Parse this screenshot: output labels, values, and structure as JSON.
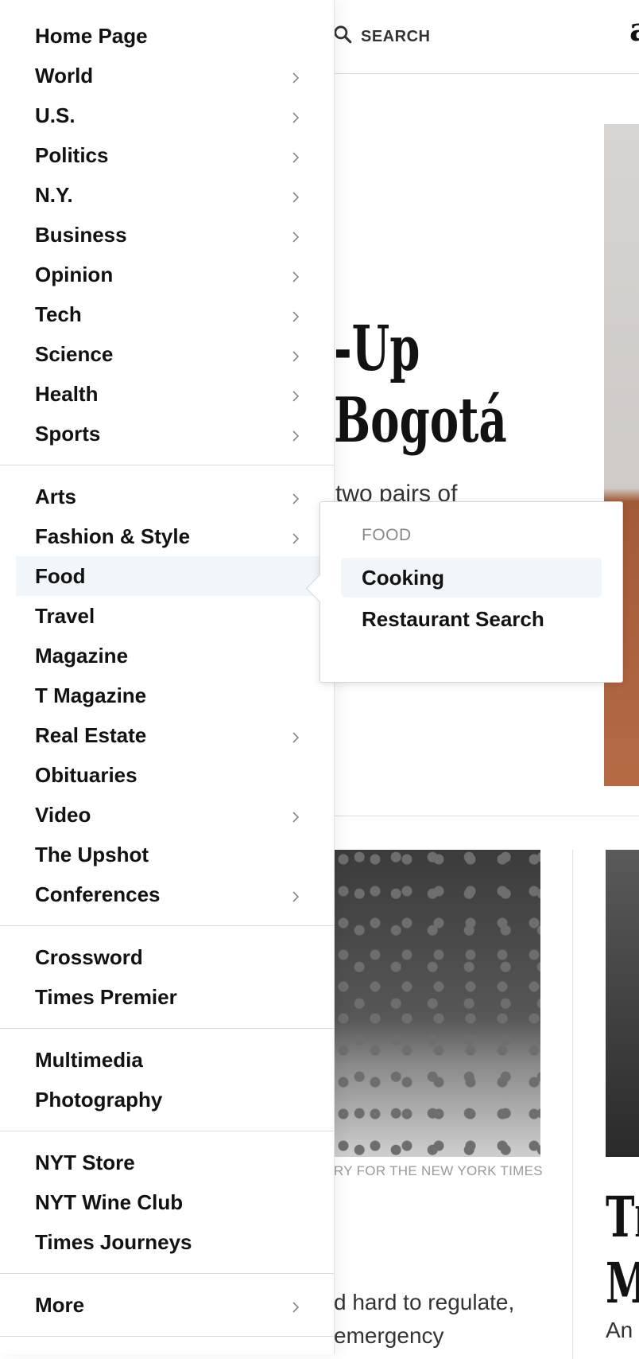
{
  "header": {
    "search_label": "SEARCH",
    "brand_glyph": "a"
  },
  "story": {
    "headline_line1": "-Up",
    "headline_line2": "Bogotá",
    "summary": "two pairs of",
    "photo_credit": "RY FOR THE NEW YORK TIMES",
    "side_headline": "Tl\nM",
    "lede_line1": "d hard to regulate,",
    "lede_line2": "emergency",
    "lede_right": "An"
  },
  "menu": {
    "sections": [
      [
        {
          "label": "Home Page",
          "chevron": false
        },
        {
          "label": "World",
          "chevron": true
        },
        {
          "label": "U.S.",
          "chevron": true
        },
        {
          "label": "Politics",
          "chevron": true
        },
        {
          "label": "N.Y.",
          "chevron": true
        },
        {
          "label": "Business",
          "chevron": true
        },
        {
          "label": "Opinion",
          "chevron": true
        },
        {
          "label": "Tech",
          "chevron": true
        },
        {
          "label": "Science",
          "chevron": true
        },
        {
          "label": "Health",
          "chevron": true
        },
        {
          "label": "Sports",
          "chevron": true
        }
      ],
      [
        {
          "label": "Arts",
          "chevron": true
        },
        {
          "label": "Fashion & Style",
          "chevron": true
        },
        {
          "label": "Food",
          "chevron": false,
          "active": true
        },
        {
          "label": "Travel",
          "chevron": false
        },
        {
          "label": "Magazine",
          "chevron": false
        },
        {
          "label": "T Magazine",
          "chevron": false
        },
        {
          "label": "Real Estate",
          "chevron": true
        },
        {
          "label": "Obituaries",
          "chevron": false
        },
        {
          "label": "Video",
          "chevron": true
        },
        {
          "label": "The Upshot",
          "chevron": false
        },
        {
          "label": "Conferences",
          "chevron": true
        }
      ],
      [
        {
          "label": "Crossword",
          "chevron": false
        },
        {
          "label": "Times Premier",
          "chevron": false
        }
      ],
      [
        {
          "label": "Multimedia",
          "chevron": false
        },
        {
          "label": "Photography",
          "chevron": false
        }
      ],
      [
        {
          "label": "NYT Store",
          "chevron": false
        },
        {
          "label": "NYT Wine Club",
          "chevron": false
        },
        {
          "label": "Times Journeys",
          "chevron": false
        }
      ],
      [
        {
          "label": "More",
          "chevron": true
        }
      ]
    ]
  },
  "flyout": {
    "title": "FOOD",
    "items": [
      {
        "label": "Cooking",
        "active": true
      },
      {
        "label": "Restaurant Search",
        "active": false
      }
    ]
  },
  "colors": {
    "active_bg": "#f0f6f9",
    "text": "#121212",
    "muted": "#888888"
  }
}
